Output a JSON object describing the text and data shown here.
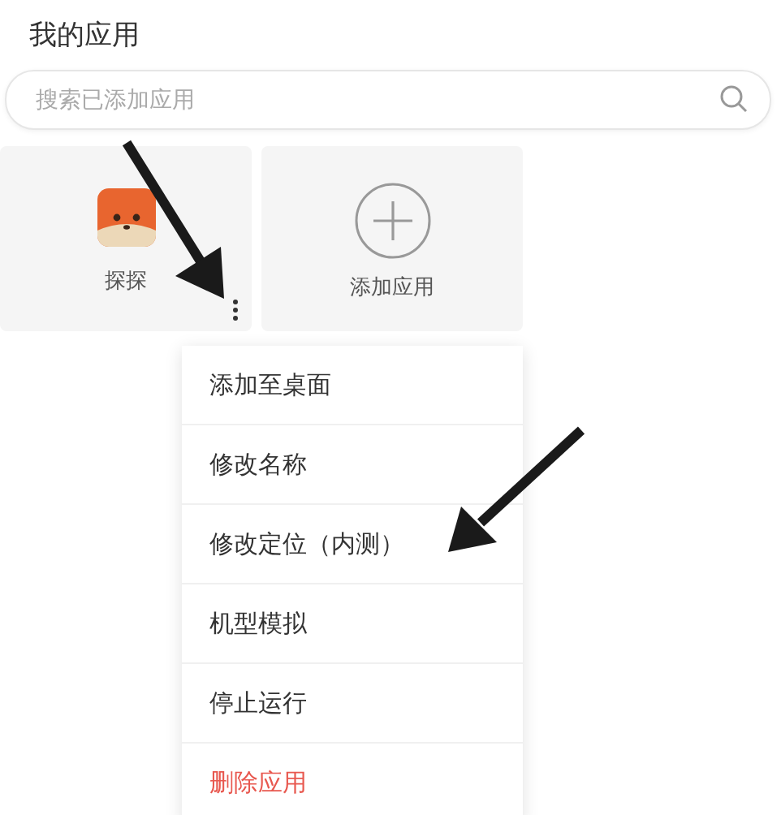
{
  "title": "我的应用",
  "search": {
    "placeholder": "搜索已添加应用"
  },
  "apps": [
    {
      "kind": "app",
      "label": "探探"
    },
    {
      "kind": "add",
      "label": "添加应用"
    }
  ],
  "menu": [
    {
      "label": "添加至桌面",
      "kind": "normal"
    },
    {
      "label": "修改名称",
      "kind": "normal"
    },
    {
      "label": "修改定位（内测）",
      "kind": "normal"
    },
    {
      "label": "机型模拟",
      "kind": "normal"
    },
    {
      "label": "停止运行",
      "kind": "normal"
    },
    {
      "label": "删除应用",
      "kind": "danger"
    }
  ]
}
